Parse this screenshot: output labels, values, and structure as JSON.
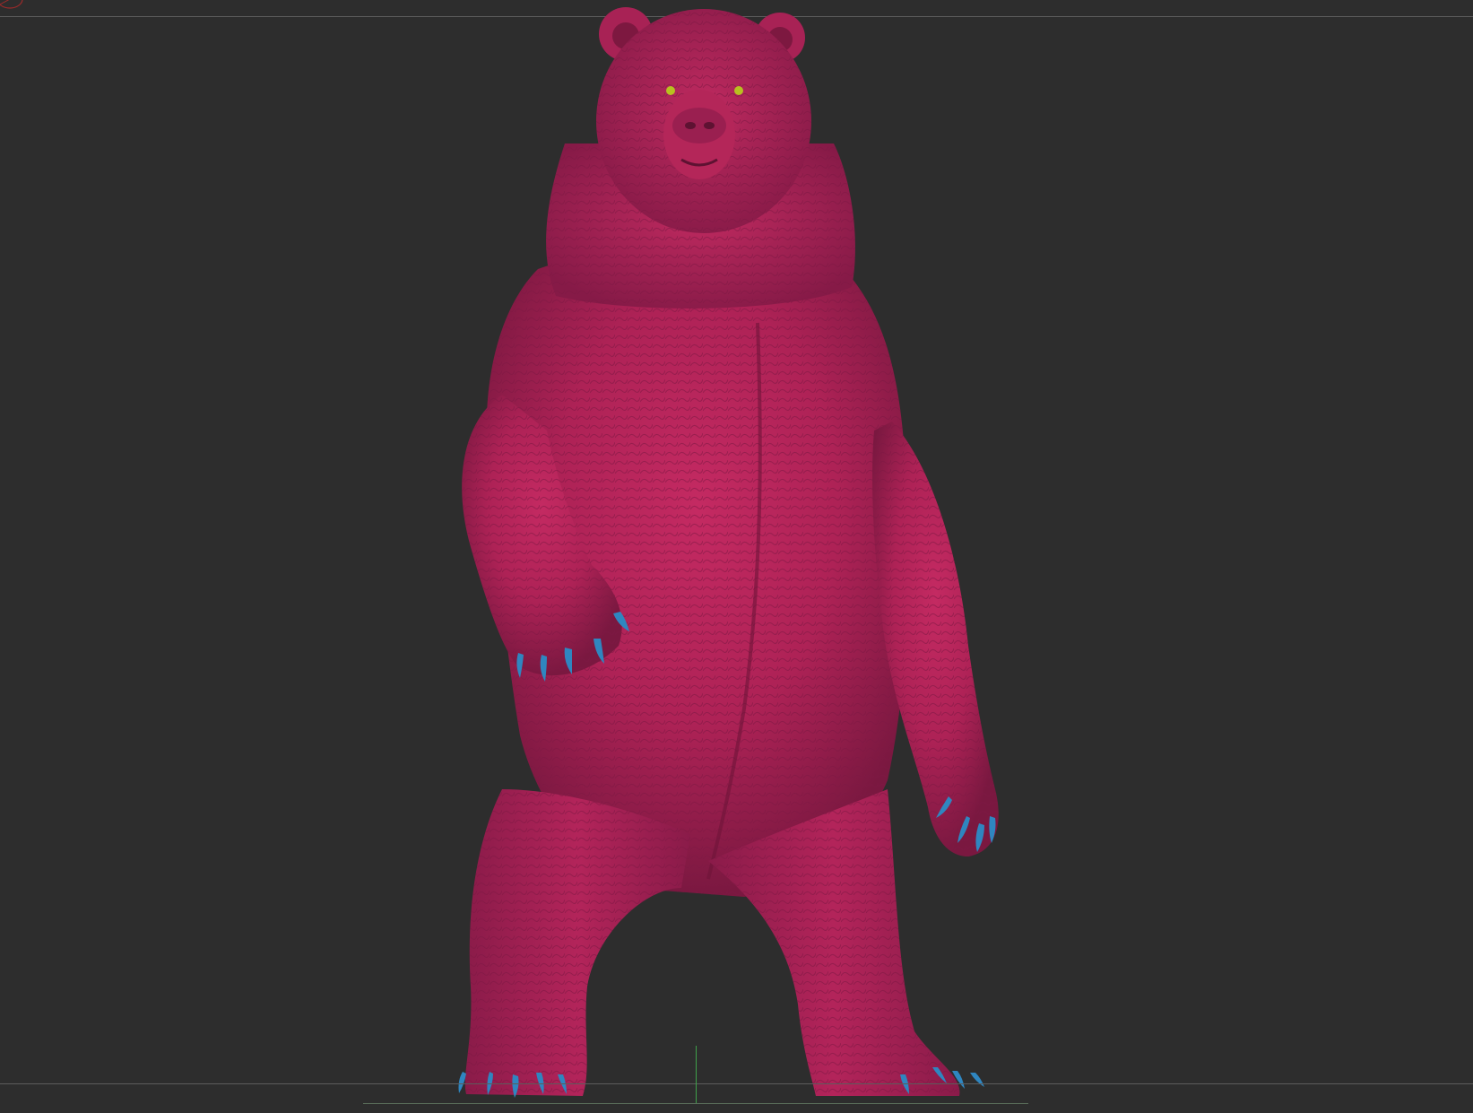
{
  "viewport": {
    "background": "#2d2d2d",
    "border_color": "#5c5c5c"
  },
  "model": {
    "subject": "bear-sculpt",
    "body_color": "#b4245a",
    "claw_color": "#2f86c0",
    "eye_color": "#b8c020"
  },
  "gizmo": {
    "icon": "axis-gizmo-icon",
    "color": "#9b2a2a"
  },
  "floor_grid": {
    "line_color": "#5b6f5b",
    "axis_color": "#3fa24a"
  }
}
